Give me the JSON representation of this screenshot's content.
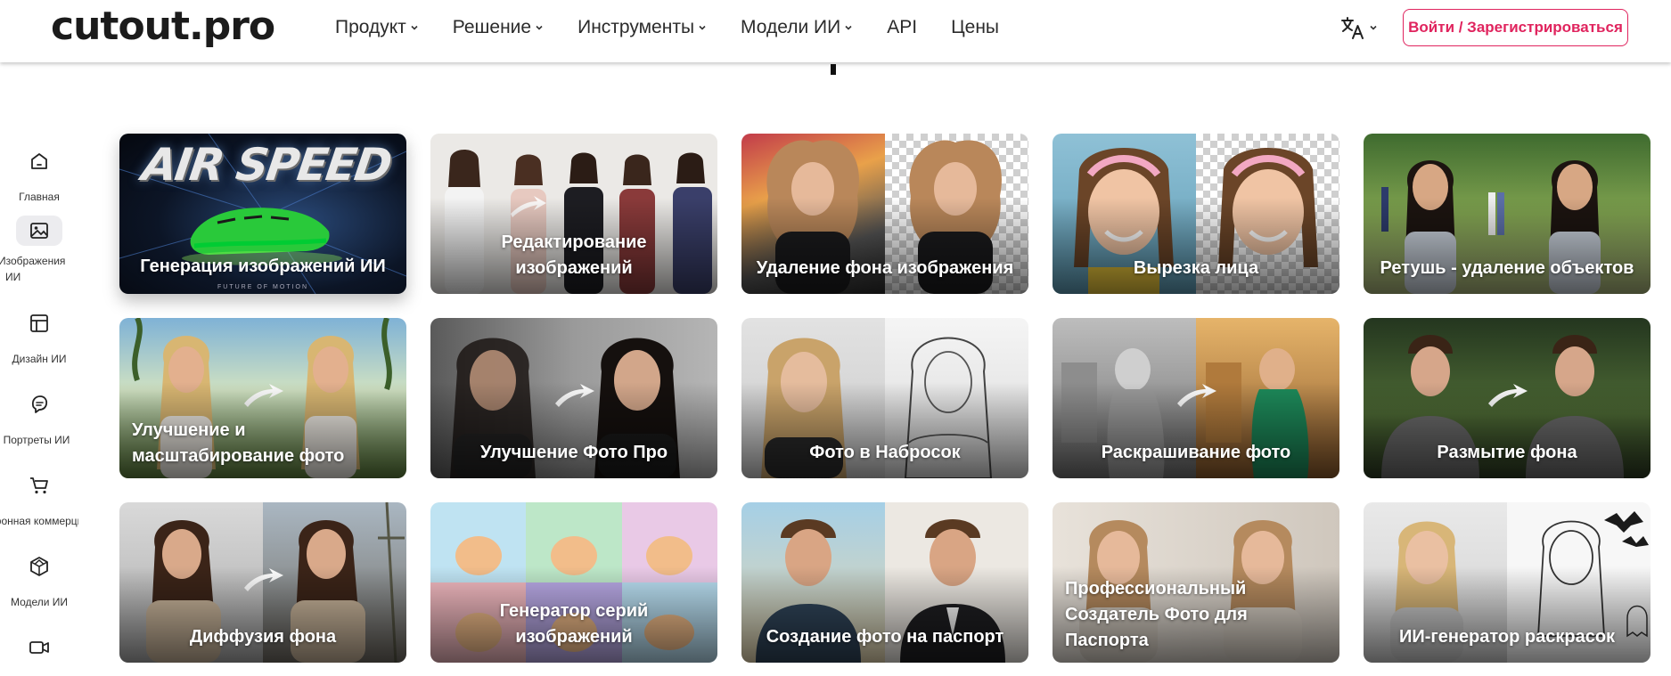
{
  "header": {
    "logo": "cutout.pro",
    "nav": [
      {
        "label": "Продукт",
        "has_dropdown": true
      },
      {
        "label": "Решение",
        "has_dropdown": true
      },
      {
        "label": "Инструменты",
        "has_dropdown": true
      },
      {
        "label": "Модели ИИ",
        "has_dropdown": true
      },
      {
        "label": "API",
        "has_dropdown": false
      },
      {
        "label": "Цены",
        "has_dropdown": false
      }
    ],
    "language_icon": "translate-icon",
    "login_label": "Войти / Зарегистрироваться",
    "accent_color": "#e0245e"
  },
  "sidebar": {
    "items": [
      {
        "label": "Главная",
        "icon": "home-icon",
        "active": false
      },
      {
        "label": "Изображения ИИ",
        "icon": "image-icon",
        "active": true
      },
      {
        "label": "Дизайн ИИ",
        "icon": "layout-icon",
        "active": false
      },
      {
        "label": "Портреты ИИ",
        "icon": "portrait-icon",
        "active": false
      },
      {
        "label": "Электронная коммерция",
        "icon": "cart-icon",
        "active": false
      },
      {
        "label": "Модели ИИ",
        "icon": "cube-icon",
        "active": false
      },
      {
        "label": "",
        "icon": "video-icon",
        "active": false
      }
    ]
  },
  "cards": [
    {
      "title": "Генерация изображений ИИ",
      "banner_text": "AIR SPEED",
      "tagline": "FUTURE OF MOTION"
    },
    {
      "title": "Редактирование изображений"
    },
    {
      "title": "Удаление фона изображения"
    },
    {
      "title": "Вырезка лица"
    },
    {
      "title": "Ретушь - удаление объектов"
    },
    {
      "title": "Улучшение и масштабирование фото"
    },
    {
      "title": "Улучшение Фото Про"
    },
    {
      "title": "Фото в Набросок"
    },
    {
      "title": "Раскрашивание фото"
    },
    {
      "title": "Размытие фона"
    },
    {
      "title": "Диффузия фона"
    },
    {
      "title": "Генератор серий изображений"
    },
    {
      "title": "Создание фото на паспорт"
    },
    {
      "title": "Профессиональный Создатель Фото для Паспорта"
    },
    {
      "title": "ИИ-генератор раскрасок"
    }
  ]
}
